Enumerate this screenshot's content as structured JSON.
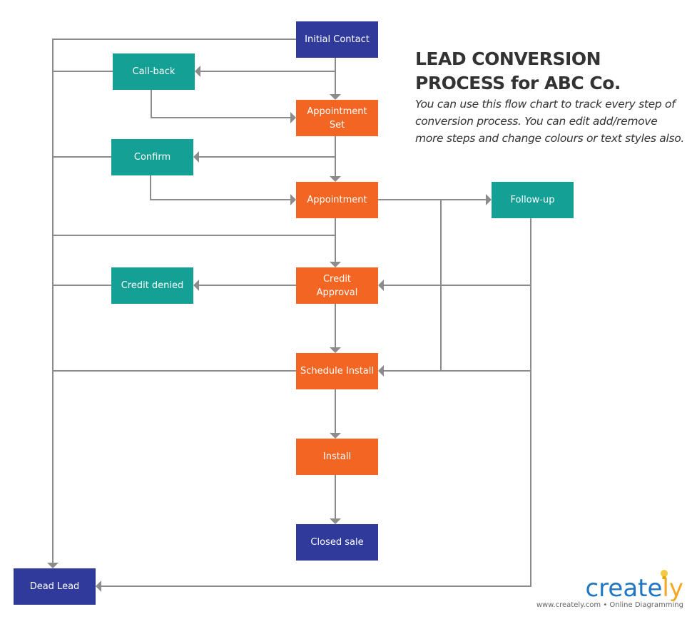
{
  "colors": {
    "start_end": "#303a9b",
    "process": "#f26522",
    "branch": "#14a094",
    "connector": "#8c8c8c",
    "title_text": "#333333",
    "logo_blue": "#1f77c4",
    "logo_accent": "#f5a623"
  },
  "header": {
    "title": "LEAD CONVERSION PROCESS for ABC Co.",
    "description": "You can use this flow chart to track every step of conversion process. You can edit add/remove more steps and change colours or text styles also."
  },
  "nodes": {
    "initial_contact": {
      "label": "Initial Contact",
      "kind": "start_end"
    },
    "call_back": {
      "label": "Call-back",
      "kind": "branch"
    },
    "appointment_set": {
      "label": "Appointment\nSet",
      "kind": "process"
    },
    "confirm": {
      "label": "Confirm",
      "kind": "branch"
    },
    "appointment": {
      "label": "Appointment",
      "kind": "process"
    },
    "follow_up": {
      "label": "Follow-up",
      "kind": "branch"
    },
    "credit_denied": {
      "label": "Credit denied",
      "kind": "branch"
    },
    "credit_approval": {
      "label": "Credit\nApproval",
      "kind": "process"
    },
    "schedule_install": {
      "label": "Schedule Install",
      "kind": "process"
    },
    "install": {
      "label": "Install",
      "kind": "process"
    },
    "closed_sale": {
      "label": "Closed sale",
      "kind": "start_end"
    },
    "dead_lead": {
      "label": "Dead Lead",
      "kind": "start_end"
    }
  },
  "edges": [
    {
      "from": "initial_contact",
      "to": "appointment_set"
    },
    {
      "from": "initial_contact",
      "to": "call_back"
    },
    {
      "from": "initial_contact",
      "to": "dead_lead"
    },
    {
      "from": "call_back",
      "to": "appointment_set"
    },
    {
      "from": "call_back",
      "to": "dead_lead"
    },
    {
      "from": "appointment_set",
      "to": "appointment"
    },
    {
      "from": "appointment_set",
      "to": "confirm"
    },
    {
      "from": "confirm",
      "to": "appointment"
    },
    {
      "from": "confirm",
      "to": "dead_lead"
    },
    {
      "from": "appointment",
      "to": "credit_approval"
    },
    {
      "from": "appointment",
      "to": "follow_up"
    },
    {
      "from": "appointment",
      "to": "schedule_install"
    },
    {
      "from": "appointment",
      "to": "dead_lead"
    },
    {
      "from": "follow_up",
      "to": "credit_approval"
    },
    {
      "from": "follow_up",
      "to": "schedule_install"
    },
    {
      "from": "follow_up",
      "to": "dead_lead"
    },
    {
      "from": "credit_approval",
      "to": "credit_denied"
    },
    {
      "from": "credit_approval",
      "to": "schedule_install"
    },
    {
      "from": "credit_denied",
      "to": "dead_lead"
    },
    {
      "from": "schedule_install",
      "to": "install"
    },
    {
      "from": "schedule_install",
      "to": "dead_lead"
    },
    {
      "from": "install",
      "to": "closed_sale"
    }
  ],
  "branding": {
    "logo_text_main": "create",
    "logo_text_accent": "ly",
    "tagline": "www.creately.com • Online Diagramming"
  }
}
